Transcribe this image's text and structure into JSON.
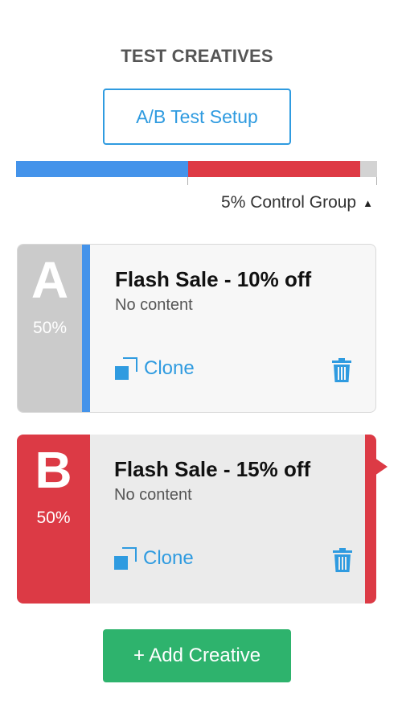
{
  "header": {
    "title": "TEST CREATIVES",
    "ab_setup_label": "A/B Test Setup"
  },
  "split": {
    "variant_a_percent": 47.5,
    "variant_b_percent": 47.5,
    "control_percent": 5,
    "colors": {
      "a": "#4493ea",
      "b": "#de3a45",
      "control": "#d3d3d3"
    }
  },
  "control_group": {
    "label": "5% Control Group",
    "caret": "▲"
  },
  "creatives": [
    {
      "letter": "A",
      "percent": "50%",
      "title": "Flash Sale - 10% off",
      "subtitle": "No content",
      "clone_label": "Clone",
      "color": "#4493ea",
      "selected": false
    },
    {
      "letter": "B",
      "percent": "50%",
      "title": "Flash Sale - 15% off",
      "subtitle": "No content",
      "clone_label": "Clone",
      "color": "#dc3a45",
      "selected": true
    }
  ],
  "add_creative_label": "+ Add Creative",
  "icons": {
    "clone": "clone-icon",
    "delete": "trash-icon",
    "caret": "caret-up-icon"
  }
}
